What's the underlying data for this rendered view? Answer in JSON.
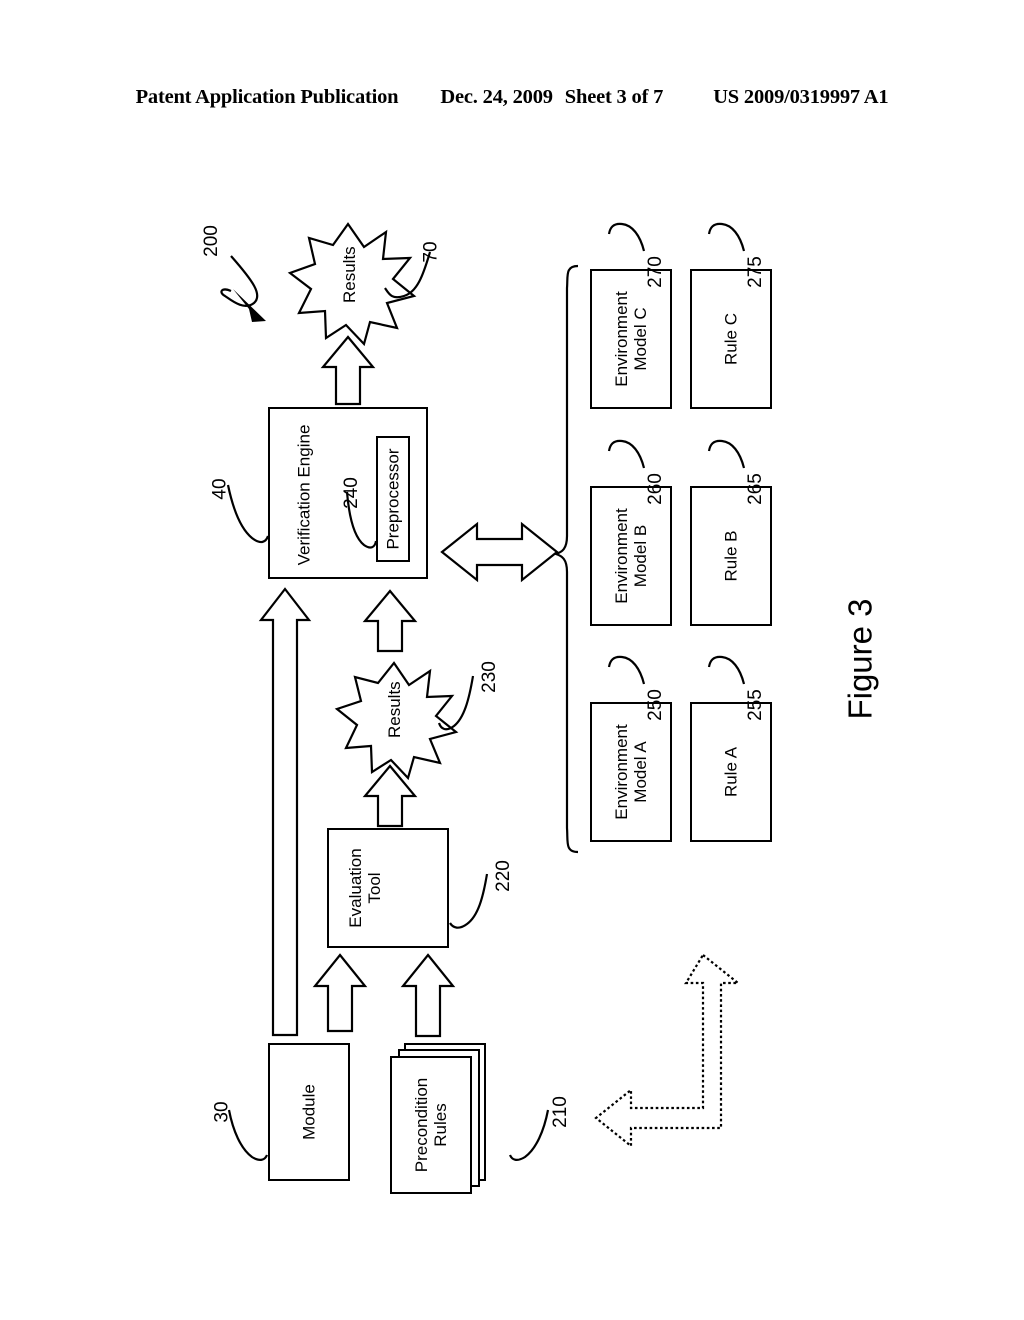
{
  "header": {
    "publication": "Patent Application Publication",
    "date": "Dec. 24, 2009",
    "sheet": "Sheet 3 of 7",
    "docnumber": "US 2009/0319997 A1"
  },
  "figure": {
    "caption": "Figure 3",
    "system_ref": "200"
  },
  "nodes": [
    {
      "id": "results_top",
      "label": "Results",
      "ref": "70",
      "shape": "starburst"
    },
    {
      "id": "verification_engine",
      "label": "Verification Engine",
      "ref": "40",
      "shape": "box"
    },
    {
      "id": "preprocessor",
      "label": "Preprocessor",
      "ref": "240",
      "shape": "box"
    },
    {
      "id": "results_mid",
      "label": "Results",
      "ref": "230",
      "shape": "starburst"
    },
    {
      "id": "evaluation_tool",
      "label": "Evaluation\nTool",
      "ref": "220",
      "shape": "box"
    },
    {
      "id": "module",
      "label": "Module",
      "ref": "30",
      "shape": "box"
    },
    {
      "id": "precondition_rules",
      "label": "Precondition\nRules",
      "ref": "210",
      "shape": "stack"
    },
    {
      "id": "env_model_a",
      "label": "Environment\nModel A",
      "ref": "250",
      "shape": "box"
    },
    {
      "id": "rule_a",
      "label": "Rule A",
      "ref": "255",
      "shape": "box"
    },
    {
      "id": "env_model_b",
      "label": "Environment\nModel B",
      "ref": "260",
      "shape": "box"
    },
    {
      "id": "rule_b",
      "label": "Rule B",
      "ref": "265",
      "shape": "box"
    },
    {
      "id": "env_model_c",
      "label": "Environment\nModel C",
      "ref": "270",
      "shape": "box"
    },
    {
      "id": "rule_c",
      "label": "Rule C",
      "ref": "275",
      "shape": "box"
    }
  ],
  "labels": {
    "results_top_line1": "Results",
    "results_mid_line1": "Results",
    "verification_engine": "Verification Engine",
    "preprocessor": "Preprocessor",
    "evaluation_tool_line1": "Evaluation",
    "evaluation_tool_line2": "Tool",
    "module": "Module",
    "precondition_line1": "Precondition",
    "precondition_line2": "Rules",
    "env_a_line1": "Environment",
    "env_a_line2": "Model A",
    "env_b_line1": "Environment",
    "env_b_line2": "Model B",
    "env_c_line1": "Environment",
    "env_c_line2": "Model C",
    "rule_a": "Rule A",
    "rule_b": "Rule B",
    "rule_c": "Rule C"
  },
  "refs": {
    "system": "200",
    "results_top": "70",
    "verification_engine": "40",
    "preprocessor": "240",
    "results_mid": "230",
    "evaluation_tool": "220",
    "module": "30",
    "precondition_rules": "210",
    "env_model_a": "250",
    "rule_a": "255",
    "env_model_b": "260",
    "rule_b": "265",
    "env_model_c": "270",
    "rule_c": "275"
  },
  "colors": {
    "ink": "#000000",
    "paper": "#ffffff"
  }
}
